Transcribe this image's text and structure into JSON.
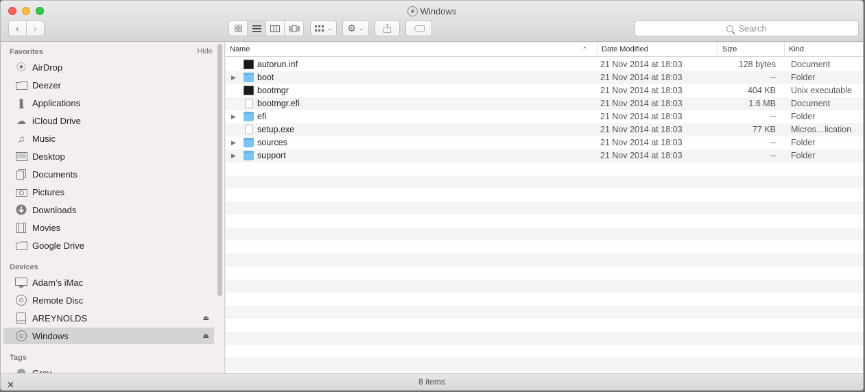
{
  "window": {
    "title": "Windows"
  },
  "toolbar": {
    "back_icon": "chevron-left-icon",
    "forward_icon": "chevron-right-icon",
    "view_modes": [
      "icon-view",
      "list-view",
      "column-view",
      "cover-flow-view"
    ],
    "active_view": "list-view",
    "arrange_icon": "grid-arrange-icon",
    "action_icon": "gear-icon",
    "share_icon": "share-icon",
    "tag_icon": "tag-icon",
    "search_placeholder": "Search"
  },
  "sidebar": {
    "favorites_label": "Favorites",
    "hide_label": "Hide",
    "favorites": [
      {
        "label": "AirDrop",
        "icon": "airdrop-icon"
      },
      {
        "label": "Deezer",
        "icon": "folder-icon"
      },
      {
        "label": "Applications",
        "icon": "applications-icon"
      },
      {
        "label": "iCloud Drive",
        "icon": "cloud-icon"
      },
      {
        "label": "Music",
        "icon": "music-icon"
      },
      {
        "label": "Desktop",
        "icon": "desktop-icon"
      },
      {
        "label": "Documents",
        "icon": "documents-icon"
      },
      {
        "label": "Pictures",
        "icon": "camera-icon"
      },
      {
        "label": "Downloads",
        "icon": "download-icon"
      },
      {
        "label": "Movies",
        "icon": "film-icon"
      },
      {
        "label": "Google Drive",
        "icon": "folder-icon"
      }
    ],
    "devices_label": "Devices",
    "devices": [
      {
        "label": "Adam’s iMac",
        "icon": "imac-icon",
        "eject": false
      },
      {
        "label": "Remote Disc",
        "icon": "disc-icon",
        "eject": false
      },
      {
        "label": "AREYNOLDS",
        "icon": "drive-icon",
        "eject": true
      },
      {
        "label": "Windows",
        "icon": "disc-icon",
        "eject": true,
        "selected": true
      }
    ],
    "tags_label": "Tags",
    "tags": [
      {
        "label": "Gray",
        "color": "#a0a0a0"
      }
    ]
  },
  "list": {
    "columns": [
      "Name",
      "Date Modified",
      "Size",
      "Kind"
    ],
    "sort_column": "Name",
    "rows": [
      {
        "name": "autorun.inf",
        "date": "21 Nov 2014 at 18:03",
        "size": "128 bytes",
        "kind": "Document",
        "type": "exec",
        "expandable": false
      },
      {
        "name": "boot",
        "date": "21 Nov 2014 at 18:03",
        "size": "--",
        "kind": "Folder",
        "type": "folder",
        "expandable": true
      },
      {
        "name": "bootmgr",
        "date": "21 Nov 2014 at 18:03",
        "size": "404 KB",
        "kind": "Unix executable",
        "type": "exec",
        "expandable": false
      },
      {
        "name": "bootmgr.efi",
        "date": "21 Nov 2014 at 18:03",
        "size": "1.6 MB",
        "kind": "Document",
        "type": "doc",
        "expandable": false
      },
      {
        "name": "efi",
        "date": "21 Nov 2014 at 18:03",
        "size": "--",
        "kind": "Folder",
        "type": "folder",
        "expandable": true
      },
      {
        "name": "setup.exe",
        "date": "21 Nov 2014 at 18:03",
        "size": "77 KB",
        "kind": "Micros…lication",
        "type": "doc",
        "expandable": false
      },
      {
        "name": "sources",
        "date": "21 Nov 2014 at 18:03",
        "size": "--",
        "kind": "Folder",
        "type": "folder",
        "expandable": true
      },
      {
        "name": "support",
        "date": "21 Nov 2014 at 18:03",
        "size": "--",
        "kind": "Folder",
        "type": "folder",
        "expandable": true
      }
    ]
  },
  "status": {
    "item_count": "8 items"
  }
}
